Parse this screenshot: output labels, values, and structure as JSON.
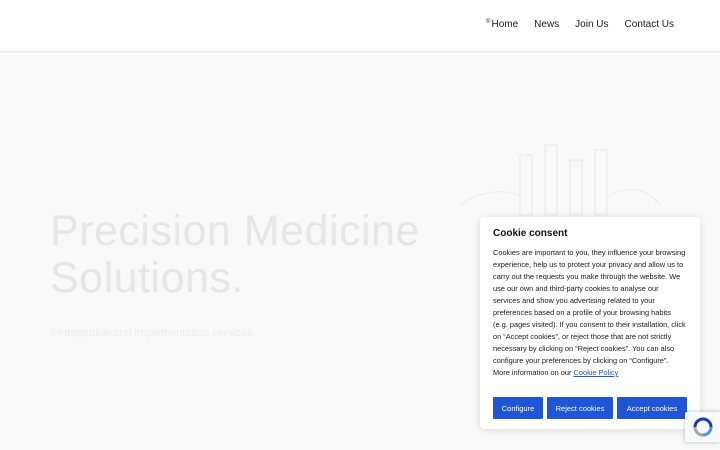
{
  "nav": {
    "items": [
      {
        "label": "Home"
      },
      {
        "label": "News"
      },
      {
        "label": "Join Us"
      },
      {
        "label": "Contact Us"
      }
    ],
    "home_mark": "®"
  },
  "hero": {
    "title_line1": "Precision Medicine",
    "title_line2": "Solutions.",
    "subtitle": "Integration and implementation services",
    "subtitle_mark": "®"
  },
  "cookie": {
    "title": "Cookie consent",
    "body": "Cookies are important to you, they influence your browsing experience, help us to protect your privacy and allow us to carry out the requests you make through the website. We use our own and third-party cookies to analyse our services and show you advertising related to your preferences based on a profile of your browsing habits (e.g. pages visited). If you consent to their installation, click on “Accept cookies”, or reject those that are not strictly necessary by clicking on “Reject cookies”. You can also configure your preferences by clicking on “Configure”. More information on our",
    "link": "Cookie Policy",
    "buttons": {
      "configure": "Configure",
      "reject": "Reject cookies",
      "accept": "Accept cookies"
    }
  },
  "colors": {
    "accent": "#1f55d8",
    "hero_text": "#e6e6e6",
    "background": "#f8f8f8"
  },
  "icons": {
    "recaptcha": "recaptcha-icon"
  }
}
